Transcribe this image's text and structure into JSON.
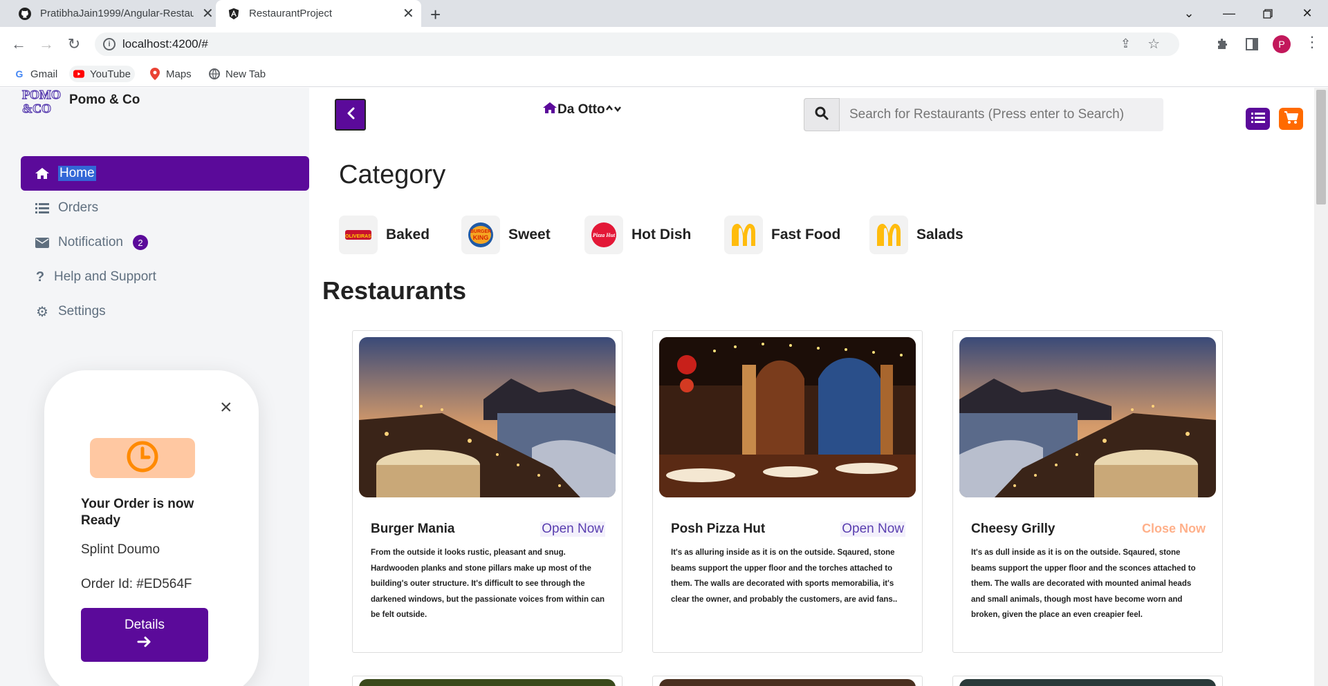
{
  "browser": {
    "tabs": [
      {
        "title": "PratibhaJain1999/Angular-Restau",
        "icon": "github-icon"
      },
      {
        "title": "RestaurantProject",
        "icon": "angular-icon"
      }
    ],
    "url": "localhost:4200/#",
    "profile_initial": "P",
    "bookmarks": [
      {
        "label": "Gmail",
        "icon": "google-icon"
      },
      {
        "label": "YouTube",
        "icon": "youtube-icon"
      },
      {
        "label": "Maps",
        "icon": "maps-icon"
      },
      {
        "label": "New Tab",
        "icon": "globe-icon"
      }
    ]
  },
  "sidebar": {
    "logo_text": "POMO &CO",
    "brand": "Pomo & Co",
    "items": [
      {
        "label": "Home",
        "icon": "home-icon",
        "active": true
      },
      {
        "label": "Orders",
        "icon": "list-icon"
      },
      {
        "label": "Notification",
        "icon": "envelope-icon",
        "badge": "2"
      },
      {
        "label": "Help and Support",
        "icon": "question-icon"
      },
      {
        "label": "Settings",
        "icon": "gear-icon"
      }
    ],
    "notification": {
      "title": "Your Order is now Ready",
      "name": "Splint Doumo",
      "order_id": "Order Id: #ED564F",
      "button": "Details"
    }
  },
  "header": {
    "location": "Da Otto",
    "search_placeholder": "Search for Restaurants (Press enter to Search)"
  },
  "category": {
    "heading": "Category",
    "items": [
      {
        "label": "Baked",
        "logo": "OLIVEIRAS"
      },
      {
        "label": "Sweet",
        "logo": "BURGER KING"
      },
      {
        "label": "Hot Dish",
        "logo": "Pizza Hut"
      },
      {
        "label": "Fast Food",
        "logo": "M"
      },
      {
        "label": "Salads",
        "logo": "M"
      }
    ]
  },
  "restaurants": {
    "heading": "Restaurants",
    "cards": [
      {
        "name": "Burger Mania",
        "status": "Open Now",
        "status_color": "#5a3fb0",
        "description": "From the outside it looks rustic, pleasant and snug. Hardwooden planks and stone pillars make up most of the building's outer structure. It's difficult to see through the darkened windows, but the passionate voices from within can be felt outside."
      },
      {
        "name": "Posh Pizza Hut",
        "status": "Open Now",
        "status_color": "#5a3fb0",
        "description": "It's as alluring inside as it is on the outside. Sqaured, stone beams support the upper floor and the torches attached to them. The walls are decorated with sports memorabilia, it's clear the owner, and probably the customers, are avid fans.."
      },
      {
        "name": "Cheesy Grilly",
        "status": "Close Now",
        "status_color": "#ffb08a",
        "description": "It's as dull inside as it is on the outside. Sqaured, stone beams support the upper floor and the sconces attached to them. The walls are decorated with mounted animal heads and small animals, though most have become worn and broken, given the place an even creapier feel."
      }
    ]
  },
  "colors": {
    "accent": "#5b0a9a",
    "cart": "#ff6a00",
    "open": "#5a3fb0",
    "closed": "#ffb08a"
  }
}
